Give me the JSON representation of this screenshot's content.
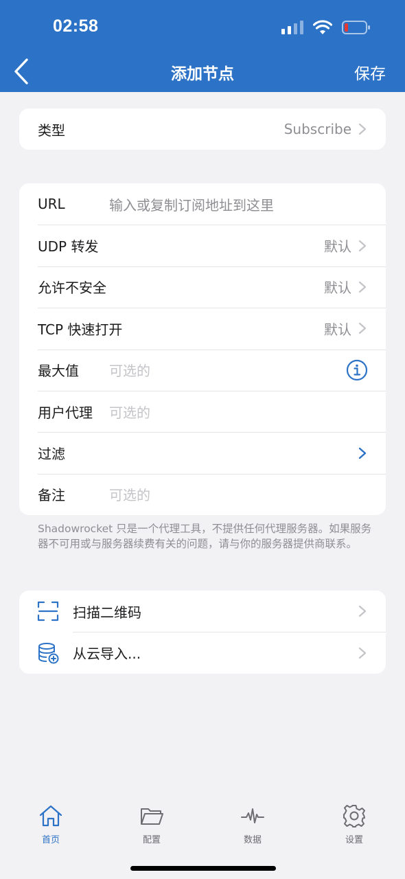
{
  "status_bar": {
    "time": "02:58"
  },
  "nav": {
    "title": "添加节点",
    "save_label": "保存"
  },
  "type_card": {
    "label": "类型",
    "value": "Subscribe"
  },
  "settings": {
    "url_label": "URL",
    "url_placeholder": "输入或复制订阅地址到这里",
    "udp_label": "UDP 转发",
    "udp_value": "默认",
    "insecure_label": "允许不安全",
    "insecure_value": "默认",
    "tcp_fast_open_label": "TCP 快速打开",
    "tcp_fast_open_value": "默认",
    "max_label": "最大值",
    "max_placeholder": "可选的",
    "user_agent_label": "用户代理",
    "user_agent_placeholder": "可选的",
    "filter_label": "过滤",
    "note_label": "备注",
    "note_placeholder": "可选的"
  },
  "footnote": "Shadowrocket 只是一个代理工具，不提供任何代理服务器。如果服务器不可用或与服务器续费有关的问题，请与你的服务器提供商联系。",
  "import_card": {
    "scan_label": "扫描二维码",
    "cloud_label": "从云导入..."
  },
  "tabbar": {
    "tabs": [
      {
        "label": "首页",
        "icon": "home-icon"
      },
      {
        "label": "配置",
        "icon": "folder-icon"
      },
      {
        "label": "数据",
        "icon": "pulse-icon"
      },
      {
        "label": "设置",
        "icon": "gear-icon"
      }
    ],
    "active_index": 0
  },
  "colors": {
    "accent": "#2c72c6",
    "background": "#f2f2f4",
    "battery_low": "#e53935"
  }
}
